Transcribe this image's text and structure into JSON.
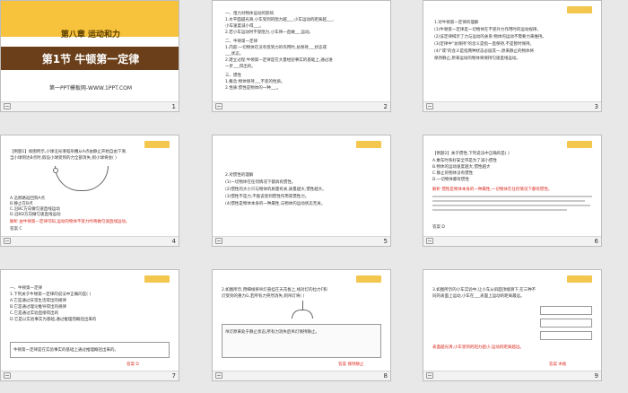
{
  "slide1": {
    "chapter": "第八章    运动和力",
    "title": "第1节    牛顿第一定律",
    "subtitle": "第一PPT模板网-WWW.1PPT.COM",
    "number": "1"
  },
  "slide2": {
    "lines": [
      "一、阻力对物体运动的影响",
      "1.水平面越光滑,小车受到的阻力越___,小车运动的距离越___,",
      "小车速度减小得___。",
      "2.若小车运动时不受阻力,小车将一直做___运动。",
      "二、牛顿第一定律",
      "1.内容:一切物体在没有受到力的作用时,总保持___状态或",
      "___状态。",
      "2.建立过程:牛顿第一定律是在大量经验事实的基础上,通过进",
      "一步___得出的。",
      "三、惯性",
      "1.概念:物体保持___不变的性质。",
      "2.性质:惯性是物体的一种___。"
    ],
    "number": "2"
  },
  "slide3": {
    "lines": [
      "1.对牛顿第一定律的理解",
      "(1)牛顿第一定律是一切物体在不受外力作用时的运动规律。",
      "(2)该定律揭示了力与运动的关系:物体的运动不需要力来维持。",
      "(3)定律中\"总保持\"的含义是指一直保持,不是暂时保持。",
      "(4)\"或\"的含义是指两种状态必居其一,原来静止的物体将",
      "保持静止,原来运动的物体将保持匀速直线运动。"
    ],
    "number": "3"
  },
  "slide4": {
    "tag": "",
    "lines": [
      "【例题1】如图所示,小球沿光滑弧形槽从A点由静止开始自由下滑,",
      "当小球到达B点时,假设小球受到的力全部消失,则小球将会(  )"
    ],
    "options": [
      "A.沿原路返回到A点",
      "B.静止在B点",
      "C.沿BC方向做匀速直线运动",
      "D.沿BD方向做匀速直线运动"
    ],
    "analysis": "解析  由牛顿第一定律可知,运动的物体不受力时将做匀速直线运动。",
    "answer": "答案  C",
    "number": "4"
  },
  "slide5": {
    "lines": [
      "2.对惯性的理解",
      "(1)一切物体在任何情况下都具有惯性。",
      "(2)惯性的大小只与物体的质量有关,质量越大,惯性越大。",
      "(3)惯性不是力,不能说受到惯性作用或惯性力。",
      "(4)惯性是物体本身的一种属性,与物体的运动状态无关。"
    ],
    "number": "5"
  },
  "slide6": {
    "lines": [
      "【例题2】关于惯性,下列说法中正确的是(  )",
      "A.乘车时系好安全带是为了减小惯性",
      "B.物体的运动速度越大,惯性越大",
      "C.静止的物体没有惯性",
      "D.一切物体都有惯性"
    ],
    "analysis": "解析  惯性是物体本身的一种属性,一切物体在任何情况下都有惯性。",
    "answer": "答案  D",
    "number": "6"
  },
  "slide7": {
    "lines": [
      "一、牛顿第一定律",
      "1.下列关于牛顿第一定律的说法中正确的是(  )",
      "A.它是通过日常生活得出的规律",
      "B.它是通过理论推导得出的规律",
      "C.它是通过实验直接得出的",
      "D.它是以实验事实为基础,通过推理而概括出来的"
    ],
    "analysis": "牛顿第一定律是在实验事实的基础上通过推理概括出来的。",
    "answer": "答案  D",
    "number": "7"
  },
  "slide8": {
    "lines": [
      "2.如图所示,用细线将吊灯悬挂在天花板上,线对灯的拉力F和",
      "灯受到的重力G,若所有力突然消失,则吊灯将(  )"
    ],
    "analysis": "吊灯原来处于静止状态,所有力消失后吊灯保持静止。",
    "answer": "答案  保持静止",
    "number": "8"
  },
  "slide9": {
    "lines": [
      "3.如图所示的小车实验中,让小车从斜面顶端滑下,在三种不",
      "同的表面上运动,小车在___表面上运动的距离最远。"
    ],
    "analysis": "表面越光滑,小车受到的阻力越小,运动的距离越远。",
    "answer": "答案  木板",
    "number": "9"
  }
}
